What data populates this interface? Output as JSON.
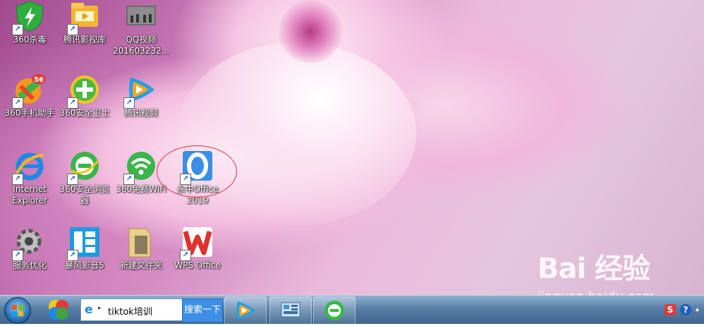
{
  "desktop": {
    "icons": [
      {
        "label": "360杀毒",
        "icon": "360-antivirus-icon"
      },
      {
        "label": "腾讯影视库",
        "icon": "folder-video-icon"
      },
      {
        "label": "QQ视频",
        "label2": "201603232...",
        "icon": "video-thumbnail-icon"
      },
      {
        "label": "360手机助手",
        "icon": "360-mobile-assistant-icon",
        "badge": "56"
      },
      {
        "label": "360安全卫士",
        "icon": "360-security-guard-icon"
      },
      {
        "label": "腾讯视频",
        "icon": "tencent-video-icon"
      },
      {
        "label": "Internet",
        "label2": "Explorer",
        "icon": "internet-explorer-icon"
      },
      {
        "label": "360安全浏览",
        "label2": "器",
        "icon": "360-browser-icon"
      },
      {
        "label": "360免费WiFi",
        "icon": "360-wifi-icon"
      },
      {
        "label": "永中Office",
        "label2": "2019",
        "icon": "yozo-office-icon"
      },
      {
        "label": "服务优化",
        "icon": "service-optimize-icon"
      },
      {
        "label": "暴风影音5",
        "icon": "baofeng-player-icon"
      },
      {
        "label": "新建文件夹",
        "icon": "folder-icon"
      },
      {
        "label": "WPS Office",
        "icon": "wps-office-icon"
      }
    ]
  },
  "taskbar": {
    "search_value": "tiktok培训",
    "search_button": "搜索一下"
  },
  "watermark": {
    "logo": "Bai 经验",
    "url": "jingyan.baidu.com"
  },
  "colors": {
    "accent": "#3d8fe6",
    "annotation": "#e0303a"
  }
}
